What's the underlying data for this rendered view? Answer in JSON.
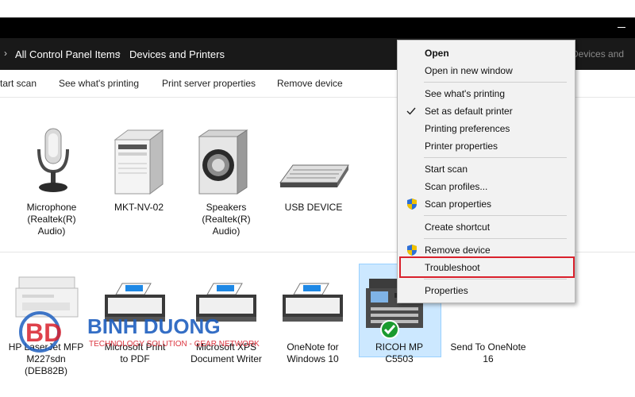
{
  "breadcrumb": {
    "items": [
      "All Control Panel Items",
      "Devices and Printers"
    ],
    "search_placeholder": "h Devices and"
  },
  "commandbar": {
    "items": [
      "tart scan",
      "See what's printing",
      "Print server properties",
      "Remove device"
    ]
  },
  "devices": [
    {
      "label": [
        "Microphone",
        "(Realtek(R)",
        "Audio)"
      ],
      "icon": "microphone-icon"
    },
    {
      "label": [
        "MKT-NV-02"
      ],
      "icon": "computer-tower-icon"
    },
    {
      "label": [
        "Speakers",
        "(Realtek(R)",
        "Audio)"
      ],
      "icon": "speaker-icon"
    },
    {
      "label": [
        "USB DEVICE"
      ],
      "icon": "keyboard-icon"
    }
  ],
  "printers": [
    {
      "label": [
        "HP LaserJet MFP",
        "M227sdn",
        "(DEB82B)"
      ],
      "icon": "multifunction-printer-icon"
    },
    {
      "label": [
        "Microsoft Print",
        "to PDF"
      ],
      "icon": "printer-icon"
    },
    {
      "label": [
        "Microsoft XPS",
        "Document Writer"
      ],
      "icon": "printer-icon"
    },
    {
      "label": [
        "OneNote for",
        "Windows 10"
      ],
      "icon": "printer-icon"
    },
    {
      "label": [
        "RICOH MP C5503"
      ],
      "icon": "copier-printer-icon",
      "default": true
    },
    {
      "label": [
        "Send To OneNote",
        "16"
      ],
      "icon": "printer-icon"
    }
  ],
  "context_menu": {
    "groups": [
      [
        {
          "label": "Open",
          "bold": true
        },
        {
          "label": "Open in new window"
        }
      ],
      [
        {
          "label": "See what's printing"
        },
        {
          "label": "Set as default printer",
          "icon": "check-icon"
        },
        {
          "label": "Printing preferences"
        },
        {
          "label": "Printer properties"
        }
      ],
      [
        {
          "label": "Start scan"
        },
        {
          "label": "Scan profiles..."
        },
        {
          "label": "Scan properties",
          "icon": "shield-icon"
        }
      ],
      [
        {
          "label": "Create shortcut"
        }
      ],
      [
        {
          "label": "Remove device",
          "icon": "shield-icon"
        },
        {
          "label": "Troubleshoot",
          "highlighted": true
        }
      ],
      [
        {
          "label": "Properties"
        }
      ]
    ]
  },
  "watermark": {
    "brand": "BINH DUONG",
    "tagline": "TECHNOLOGY SOLUTION - GEAR NETWORK",
    "logo": "BD"
  },
  "colors": {
    "titlebar": "#000000",
    "addressbar": "#191919",
    "selection": "#cce8ff",
    "highlight_border": "#d9212c",
    "brand_blue": "#1f5fbf",
    "brand_red": "#d9212c"
  }
}
